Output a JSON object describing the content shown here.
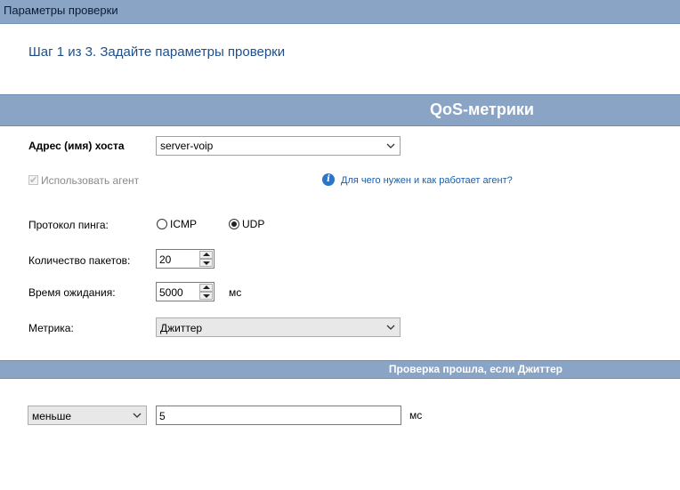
{
  "window": {
    "title": "Параметры проверки"
  },
  "step": {
    "title": "Шаг 1 из 3. Задайте параметры проверки"
  },
  "sections": {
    "qos_header": "QoS-метрики",
    "pass_header": "Проверка прошла, если Джиттер"
  },
  "host": {
    "label": "Адрес (имя) хоста",
    "value": "server-voip"
  },
  "agent": {
    "label": "Использовать агент",
    "checked": true,
    "enabled": false,
    "help_link": "Для чего нужен и как работает агент?"
  },
  "ping_protocol": {
    "label": "Протокол пинга:",
    "options": [
      "ICMP",
      "UDP"
    ],
    "selected": "UDP"
  },
  "packets": {
    "label": "Количество пакетов:",
    "value": "20"
  },
  "timeout": {
    "label": "Время ожидания:",
    "value": "5000",
    "unit": "мс"
  },
  "metric": {
    "label": "Метрика:",
    "value": "Джиттер"
  },
  "condition": {
    "operator": "меньше",
    "value": "5",
    "unit": "мс"
  },
  "icons": {
    "dropdown": "chevron-down-icon",
    "info": "info-icon",
    "check": "checkmark-icon"
  }
}
